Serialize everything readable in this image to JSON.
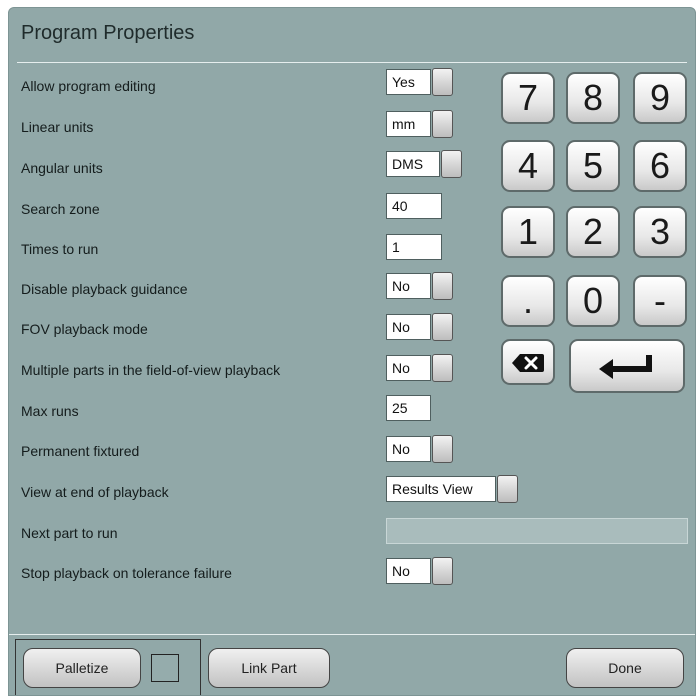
{
  "window": {
    "title": "Program Properties"
  },
  "rows": [
    {
      "label": "Allow program editing",
      "value": "Yes"
    },
    {
      "label": "Linear units",
      "value": "mm"
    },
    {
      "label": "Angular units",
      "value": "DMS"
    },
    {
      "label": "Search zone",
      "value": "40"
    },
    {
      "label": "Times to run",
      "value": "1"
    },
    {
      "label": "Disable playback guidance",
      "value": "No"
    },
    {
      "label": "FOV playback mode",
      "value": "No"
    },
    {
      "label": "Multiple parts in the field-of-view playback",
      "value": "No"
    },
    {
      "label": "Max runs",
      "value": "25"
    },
    {
      "label": "Permanent fixtured",
      "value": "No"
    },
    {
      "label": "View at end of playback",
      "value": "Results View"
    },
    {
      "label": "Next part to run",
      "value": ""
    },
    {
      "label": "Stop playback on tolerance failure",
      "value": "No"
    }
  ],
  "keypad": {
    "keys": [
      "7",
      "8",
      "9",
      "4",
      "5",
      "6",
      "1",
      "2",
      "3",
      ".",
      "0",
      "-"
    ],
    "backspace_icon": "backspace-icon",
    "enter_icon": "enter-arrow-icon"
  },
  "footer": {
    "palletize_label": "Palletize",
    "link_part_label": "Link Part",
    "done_label": "Done"
  }
}
